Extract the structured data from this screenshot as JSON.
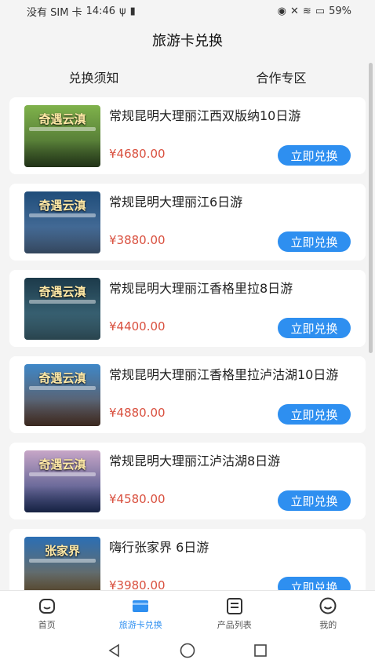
{
  "status_bar": {
    "carrier": "没有 SIM 卡",
    "time": "14:46",
    "battery": "59%"
  },
  "header": {
    "title": "旅游卡兑换"
  },
  "tabs": [
    {
      "label": "兑换须知"
    },
    {
      "label": "合作专区"
    }
  ],
  "products": [
    {
      "title": "常规昆明大理丽江西双版纳10日游",
      "price": "¥4680.00",
      "button": "立即兑换",
      "thumb_caption": "奇遇云滇",
      "thumb_top": "#7fb24b",
      "thumb_bottom": "#3c5b2a"
    },
    {
      "title": "常规昆明大理丽江6日游",
      "price": "¥3880.00",
      "button": "立即兑换",
      "thumb_caption": "奇遇云滇",
      "thumb_top": "#1f4d7a",
      "thumb_bottom": "#5c7ea8"
    },
    {
      "title": "常规昆明大理丽江香格里拉8日游",
      "price": "¥4400.00",
      "button": "立即兑换",
      "thumb_caption": "奇遇云滇",
      "thumb_top": "#1c3a4a",
      "thumb_bottom": "#4a7a8c"
    },
    {
      "title": "常规昆明大理丽江香格里拉泸沽湖10日游",
      "price": "¥4880.00",
      "button": "立即兑换",
      "thumb_caption": "奇遇云滇",
      "thumb_top": "#3f88c8",
      "thumb_bottom": "#6b4a3a"
    },
    {
      "title": "常规昆明大理丽江泸沽湖8日游",
      "price": "¥4580.00",
      "button": "立即兑换",
      "thumb_caption": "奇遇云滇",
      "thumb_top": "#c7a6c7",
      "thumb_bottom": "#2a3f7a"
    },
    {
      "title": "嗨行张家界 6日游",
      "price": "¥3980.00",
      "button": "立即兑换",
      "thumb_caption": "张家界",
      "thumb_top": "#2b6fb5",
      "thumb_bottom": "#8a6a3a"
    }
  ],
  "bottom_nav": [
    {
      "label": "首页",
      "icon": "home-icon",
      "active": false
    },
    {
      "label": "旅游卡兑换",
      "icon": "card-icon",
      "active": true
    },
    {
      "label": "产品列表",
      "icon": "list-icon",
      "active": false
    },
    {
      "label": "我的",
      "icon": "profile-icon",
      "active": false
    }
  ],
  "colors": {
    "accent": "#2e8ff0",
    "price": "#d9503f"
  }
}
